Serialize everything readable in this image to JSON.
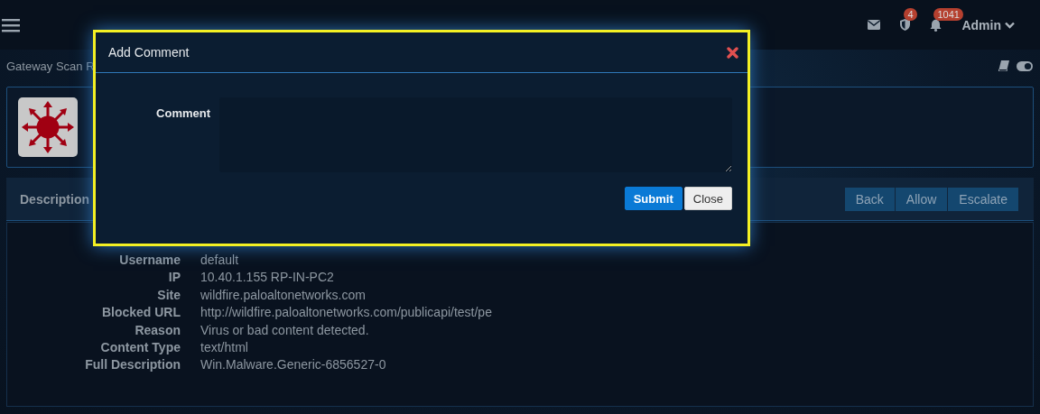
{
  "topbar": {
    "notifications": [
      {
        "kind": "mail"
      },
      {
        "kind": "shield",
        "badge": "4"
      },
      {
        "kind": "bell",
        "badge": "1041"
      }
    ],
    "user": "Admin"
  },
  "page_title": "Gateway Scan R",
  "description_bar": {
    "label": "Description",
    "buttons": [
      "Back",
      "Allow",
      "Escalate"
    ]
  },
  "details": [
    {
      "label": "Username",
      "value": "default"
    },
    {
      "label": "IP",
      "value": "10.40.1.155 RP-IN-PC2"
    },
    {
      "label": "Site",
      "value": "wildfire.paloaltonetworks.com"
    },
    {
      "label": "Blocked URL",
      "value": "http://wildfire.paloaltonetworks.com/publicapi/test/pe"
    },
    {
      "label": "Reason",
      "value": "Virus or bad content detected."
    },
    {
      "label": "Content Type",
      "value": "text/html"
    },
    {
      "label": "Full Description",
      "value": "Win.Malware.Generic-6856527-0"
    }
  ],
  "modal": {
    "title": "Add Comment",
    "field_label": "Comment",
    "buttons": [
      {
        "label": "Submit",
        "kind": "primary"
      },
      {
        "label": "Close",
        "kind": "default"
      }
    ]
  }
}
